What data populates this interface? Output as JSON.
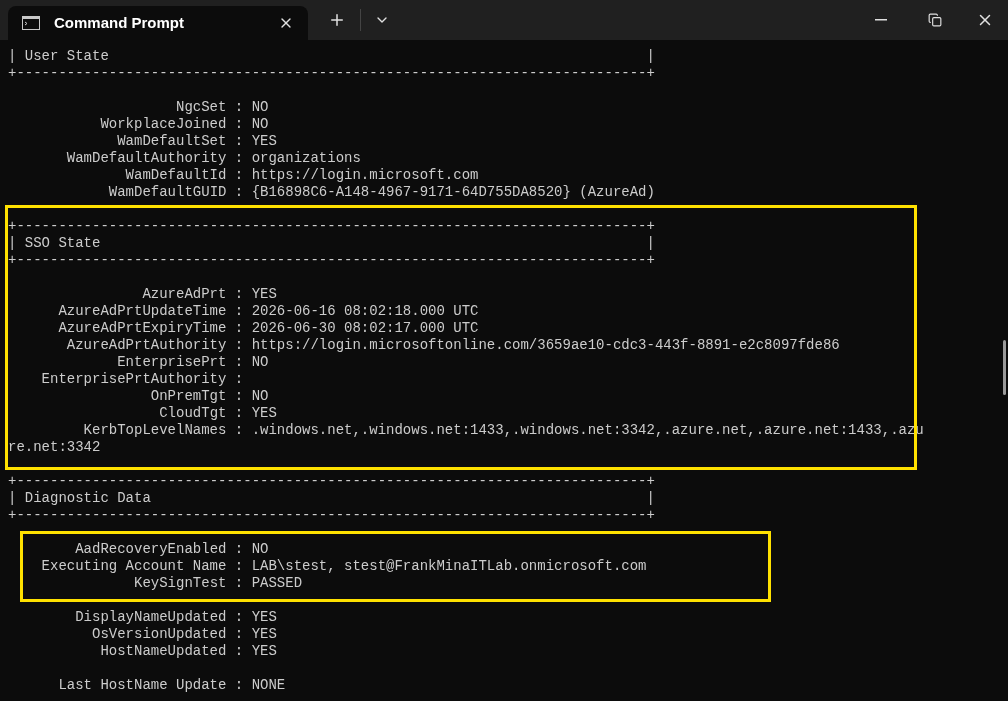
{
  "window": {
    "tab_title": "Command Prompt"
  },
  "terminal": {
    "blocks": [
      {
        "highlighted": false,
        "lines": [
          {
            "kind": "header",
            "left": "|",
            "title": "User State",
            "right": "|"
          },
          {
            "kind": "border",
            "text": "+---------------------------------------------------------------------------+"
          },
          {
            "kind": "blank"
          },
          {
            "kind": "field",
            "key": "NgcSet :",
            "value": "NO"
          },
          {
            "kind": "field",
            "key": "WorkplaceJoined :",
            "value": "NO"
          },
          {
            "kind": "field",
            "key": "WamDefaultSet :",
            "value": "YES"
          },
          {
            "kind": "field",
            "key": "WamDefaultAuthority :",
            "value": "organizations"
          },
          {
            "kind": "field",
            "key": "WamDefaultId :",
            "value": "https://login.microsoft.com"
          },
          {
            "kind": "field",
            "key": "WamDefaultGUID :",
            "value": "{B16898C6-A148-4967-9171-64D755DA8520} (AzureAd)"
          },
          {
            "kind": "blank"
          }
        ]
      },
      {
        "highlighted": true,
        "lines": [
          {
            "kind": "border",
            "text": "+---------------------------------------------------------------------------+"
          },
          {
            "kind": "header",
            "left": "|",
            "title": "SSO State",
            "right": "|"
          },
          {
            "kind": "border",
            "text": "+---------------------------------------------------------------------------+"
          },
          {
            "kind": "blank"
          },
          {
            "kind": "field",
            "key": "AzureAdPrt :",
            "value": "YES"
          },
          {
            "kind": "field",
            "key": "AzureAdPrtUpdateTime :",
            "value": "2026-06-16 08:02:18.000 UTC"
          },
          {
            "kind": "field",
            "key": "AzureAdPrtExpiryTime :",
            "value": "2026-06-30 08:02:17.000 UTC"
          },
          {
            "kind": "field",
            "key": "AzureAdPrtAuthority :",
            "value": "https://login.microsoftonline.com/3659ae10-cdc3-443f-8891-e2c8097fde86"
          },
          {
            "kind": "field",
            "key": "EnterprisePrt :",
            "value": "NO"
          },
          {
            "kind": "field",
            "key": "EnterprisePrtAuthority :"
          },
          {
            "kind": "field",
            "key": "OnPremTgt :",
            "value": "NO"
          },
          {
            "kind": "field",
            "key": "CloudTgt :",
            "value": "YES"
          },
          {
            "kind": "field",
            "key": "KerbTopLevelNames :",
            "value": ".windows.net,.windows.net:1433,.windows.net:3342,.azure.net,.azure.net:1433,.azu"
          },
          {
            "kind": "text",
            "text": "re.net:3342"
          }
        ]
      },
      {
        "highlighted": false,
        "lines": [
          {
            "kind": "blank"
          },
          {
            "kind": "border",
            "text": "+---------------------------------------------------------------------------+"
          },
          {
            "kind": "header",
            "left": "|",
            "title": "Diagnostic Data",
            "right": "|"
          },
          {
            "kind": "border",
            "text": "+---------------------------------------------------------------------------+"
          },
          {
            "kind": "blank"
          }
        ]
      },
      {
        "highlighted": true,
        "lines": [
          {
            "kind": "field",
            "key": "AadRecoveryEnabled :",
            "value": "NO"
          },
          {
            "kind": "field",
            "key": "Executing Account Name :",
            "value": "LAB\\stest, stest@FrankMinaITLab.onmicrosoft.com"
          },
          {
            "kind": "field",
            "key": "KeySignTest :",
            "value": "PASSED"
          }
        ]
      },
      {
        "highlighted": false,
        "lines": [
          {
            "kind": "blank"
          },
          {
            "kind": "field",
            "key": "DisplayNameUpdated :",
            "value": "YES"
          },
          {
            "kind": "field",
            "key": "OsVersionUpdated :",
            "value": "YES"
          },
          {
            "kind": "field",
            "key": "HostNameUpdated :",
            "value": "YES"
          },
          {
            "kind": "blank"
          },
          {
            "kind": "field",
            "key": "Last HostName Update :",
            "value": "NONE"
          }
        ]
      }
    ]
  }
}
